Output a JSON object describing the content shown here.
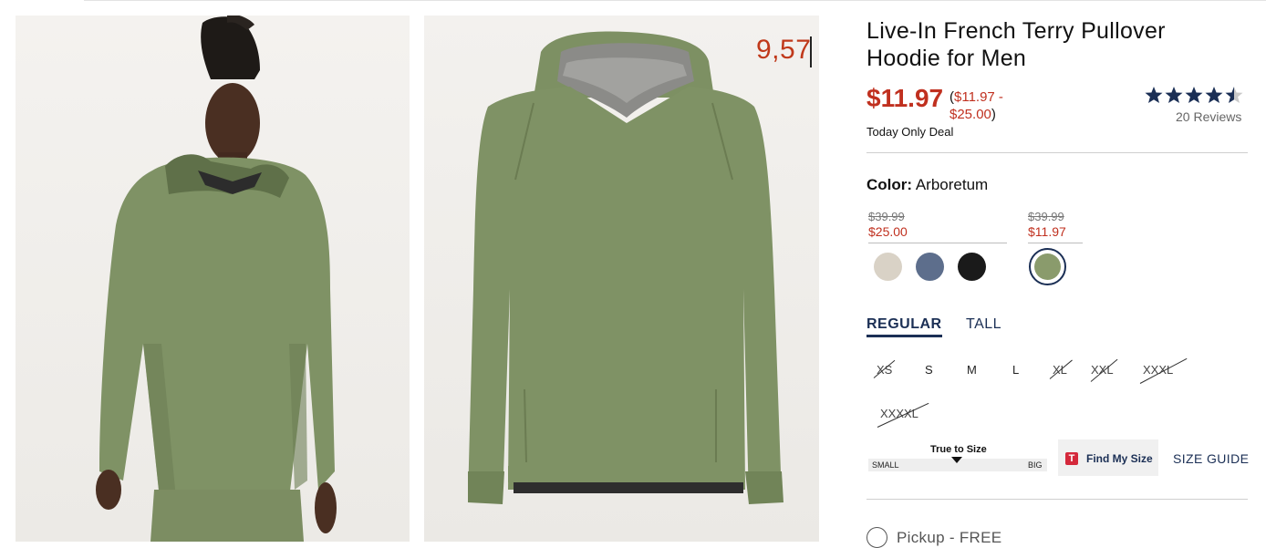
{
  "images": {
    "model_alt": "Model wearing olive green pullover hoodie",
    "flat_alt": "Olive green pullover hoodie product shot"
  },
  "overlay_text": "9,57",
  "product": {
    "title": "Live-In French Terry Pullover Hoodie for Men",
    "price": "$11.97",
    "range_open": "(",
    "range_low": "$11.97 -",
    "range_high": "$25.00",
    "range_close": ")",
    "deal_text": "Today Only Deal",
    "rating": 4.5,
    "stars": "★★★★★",
    "reviews": "20 Reviews"
  },
  "color": {
    "label": "Color:",
    "value": "Arboretum",
    "groups": [
      {
        "original": "$39.99",
        "sale": "$25.00"
      },
      {
        "original": "$39.99",
        "sale": "$11.97"
      }
    ],
    "swatches": [
      {
        "name": "swatch-oatmeal",
        "hex": "#d9d2c6"
      },
      {
        "name": "swatch-slate-blue",
        "hex": "#5d6e8c"
      },
      {
        "name": "swatch-black",
        "hex": "#1a1a1a"
      },
      {
        "name": "swatch-arboretum",
        "hex": "#8a9b6c",
        "selected": true
      }
    ]
  },
  "fit_tabs": {
    "regular": "REGULAR",
    "tall": "TALL"
  },
  "sizes": [
    {
      "label": "XS",
      "available": false
    },
    {
      "label": "S",
      "available": true
    },
    {
      "label": "M",
      "available": true
    },
    {
      "label": "L",
      "available": true
    },
    {
      "label": "XL",
      "available": false
    },
    {
      "label": "XXL",
      "available": false
    },
    {
      "label": "XXXL",
      "available": false
    },
    {
      "label": "XXXXL",
      "available": false
    }
  ],
  "fit_meter": {
    "title": "True to Size",
    "left": "SMALL",
    "right": "BIG",
    "level": 0.5
  },
  "find_size": {
    "badge": "T",
    "label": "Find My Size"
  },
  "size_guide": "SIZE GUIDE",
  "pickup": {
    "label": "Pickup - FREE"
  },
  "colors": {
    "accent": "#1b2f55",
    "sale": "#c0301f",
    "product": "#7f9265"
  }
}
